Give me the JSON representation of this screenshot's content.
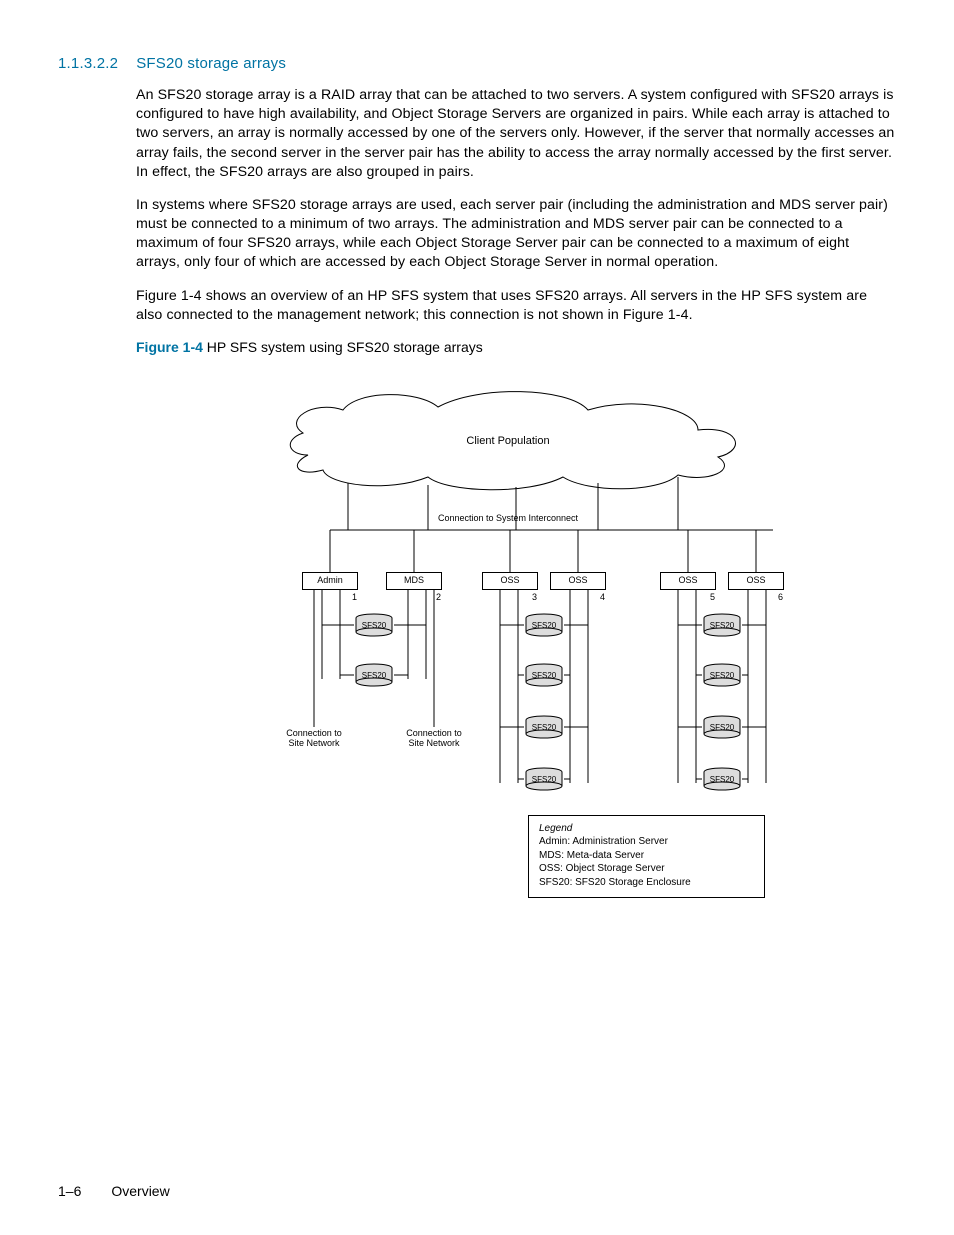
{
  "heading": {
    "number": "1.1.3.2.2",
    "title": "SFS20 storage arrays"
  },
  "paragraphs": [
    "An SFS20 storage array is a RAID array that can be attached to two servers. A system configured with SFS20 arrays is configured to have high availability, and Object Storage Servers are organized in pairs. While each array is attached to two servers, an array is normally accessed by one of the servers only. However, if the server that normally accesses an array fails, the second server in the server pair has the ability to access the array normally accessed by the first server. In effect, the SFS20 arrays are also grouped in pairs.",
    "In systems where SFS20 storage arrays are used, each server pair (including the administration and MDS server pair) must be connected to a minimum of two arrays. The administration and MDS server pair can be connected to a maximum of four SFS20 arrays, while each Object Storage Server pair can be connected to a maximum of eight arrays, only four of which are accessed by each Object Storage Server in normal operation.",
    "Figure 1-4 shows an overview of an HP SFS system that uses SFS20 arrays. All servers in the HP SFS system are also connected to the management network; this connection is not shown in Figure 1-4."
  ],
  "figure": {
    "label": "Figure 1-4",
    "caption": "HP SFS system using SFS20 storage arrays"
  },
  "diagram": {
    "cloud_label": "Client Population",
    "interconnect_label": "Connection to System Interconnect",
    "servers": [
      {
        "name": "Admin",
        "num": "1"
      },
      {
        "name": "MDS",
        "num": "2"
      },
      {
        "name": "OSS",
        "num": "3"
      },
      {
        "name": "OSS",
        "num": "4"
      },
      {
        "name": "OSS",
        "num": "5"
      },
      {
        "name": "OSS",
        "num": "6"
      }
    ],
    "sfs_label": "SFS20",
    "site_conn_label": "Connection to\nSite Network",
    "legend": {
      "title": "Legend",
      "lines": [
        "Admin: Administration Server",
        "MDS: Meta-data Server",
        "OSS: Object Storage Server",
        "SFS20: SFS20 Storage Enclosure"
      ]
    }
  },
  "footer": {
    "page": "1–6",
    "section": "Overview"
  }
}
